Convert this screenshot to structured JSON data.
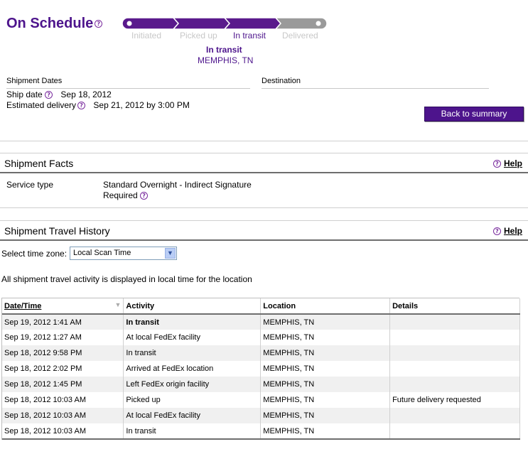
{
  "status": {
    "title": "On Schedule"
  },
  "progress": {
    "steps": [
      "Initiated",
      "Picked up",
      "In transit",
      "Delivered"
    ],
    "current_index": 2,
    "current_status": "In transit",
    "current_location": "MEMPHIS, TN",
    "colors": {
      "active": "#5a1a8c",
      "inactive": "#9a9a9a",
      "active_label": "#4d148c",
      "inactive_label": "#c8c8c8"
    }
  },
  "dates": {
    "heading": "Shipment Dates",
    "ship_label": "Ship date",
    "ship_value": "Sep 18, 2012",
    "est_label": "Estimated delivery",
    "est_value": "Sep 21, 2012 by 3:00 PM"
  },
  "destination": {
    "heading": "Destination"
  },
  "back_button": "Back to summary",
  "facts": {
    "title": "Shipment Facts",
    "help": "Help",
    "service_label": "Service type",
    "service_value_line1": "Standard Overnight - Indirect Signature",
    "service_value_line2": "Required"
  },
  "history": {
    "title": "Shipment Travel History",
    "help": "Help",
    "tz_label": "Select time zone:",
    "tz_value": "Local Scan Time",
    "note": "All shipment travel activity is displayed in local time for the location",
    "columns": [
      "Date/Time",
      "Activity",
      "Location",
      "Details"
    ],
    "rows": [
      {
        "datetime": "Sep 19, 2012 1:41 AM",
        "activity": "In transit",
        "location": "MEMPHIS, TN",
        "details": ""
      },
      {
        "datetime": "Sep 19, 2012 1:27 AM",
        "activity": "At local FedEx facility",
        "location": "MEMPHIS, TN",
        "details": ""
      },
      {
        "datetime": "Sep 18, 2012 9:58 PM",
        "activity": "In transit",
        "location": "MEMPHIS, TN",
        "details": ""
      },
      {
        "datetime": "Sep 18, 2012 2:02 PM",
        "activity": "Arrived at FedEx location",
        "location": "MEMPHIS, TN",
        "details": ""
      },
      {
        "datetime": "Sep 18, 2012 1:45 PM",
        "activity": "Left FedEx origin facility",
        "location": "MEMPHIS, TN",
        "details": ""
      },
      {
        "datetime": "Sep 18, 2012 10:03 AM",
        "activity": "Picked up",
        "location": "MEMPHIS, TN",
        "details": "Future delivery requested"
      },
      {
        "datetime": "Sep 18, 2012 10:03 AM",
        "activity": "At local FedEx facility",
        "location": "MEMPHIS, TN",
        "details": ""
      },
      {
        "datetime": "Sep 18, 2012 10:03 AM",
        "activity": "In transit",
        "location": "MEMPHIS, TN",
        "details": ""
      }
    ]
  }
}
